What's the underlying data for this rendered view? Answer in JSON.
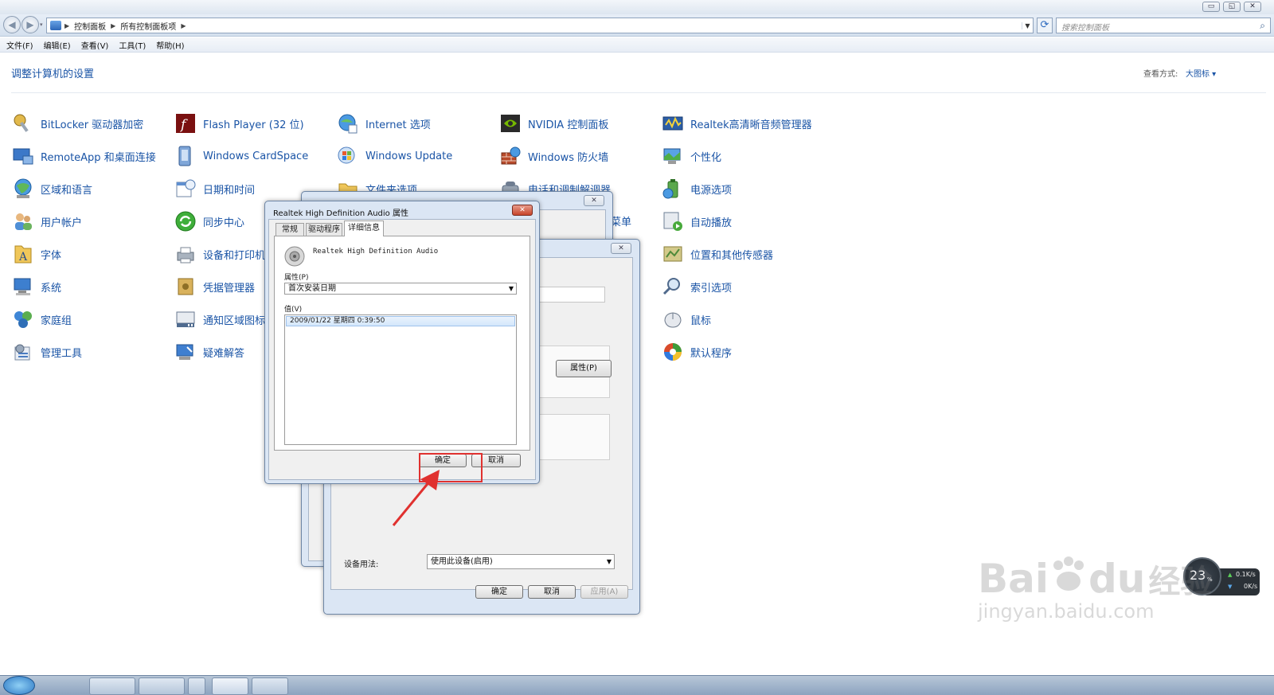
{
  "window": {
    "minimize": "▭",
    "restore": "◱",
    "close": "✕"
  },
  "address": {
    "crumbs": [
      "控制面板",
      "所有控制面板项"
    ],
    "search_placeholder": "搜索控制面板"
  },
  "menu": [
    "文件(F)",
    "编辑(E)",
    "查看(V)",
    "工具(T)",
    "帮助(H)"
  ],
  "header": {
    "title": "调整计算机的设置",
    "view_label": "查看方式:",
    "view_value": "大图标 ▾"
  },
  "columns": [
    [
      "BitLocker 驱动器加密",
      "RemoteApp 和桌面连接",
      "区域和语言",
      "用户帐户",
      "字体",
      "系统",
      "家庭组",
      "管理工具"
    ],
    [
      "Flash Player (32 位)",
      "Windows CardSpace",
      "日期和时间",
      "同步中心",
      "设备和打印机",
      "凭据管理器",
      "通知区域图标",
      "疑难解答"
    ],
    [
      "Internet 选项",
      "Windows Update"
    ],
    [
      "NVIDIA 控制面板",
      "Windows 防火墙"
    ],
    [
      "Realtek高清晰音频管理器",
      "个性化",
      "电源选项",
      "自动播放",
      "位置和其他传感器",
      "索引选项",
      "鼠标",
      "默认程序"
    ]
  ],
  "partial": {
    "col3_row3": "文件夹选项",
    "col4_row3": "电话和调制解调器",
    "col4_row4": "菜单"
  },
  "back_dialog": {
    "properties_button": "属性(P)",
    "usage_label": "设备用法:",
    "usage_value": "使用此设备(启用)",
    "ok": "确定",
    "cancel": "取消",
    "apply": "应用(A)"
  },
  "front_dialog": {
    "title": "Realtek High Definition Audio 属性",
    "tabs": [
      "常规",
      "驱动程序",
      "详细信息"
    ],
    "device_name": "Realtek High Definition Audio",
    "property_label": "属性(P)",
    "property_value": "首次安装日期",
    "value_label": "值(V)",
    "value_row": "2009/01/22 星期四 0:39:50",
    "ok": "确定",
    "cancel": "取消"
  },
  "meter": {
    "percent": "23",
    "unit": "%",
    "up": "0.1K/s",
    "down": "0K/s"
  },
  "watermark": {
    "brand": "Bai",
    "brand2": "du",
    "cn": "经验",
    "url": "jingyan.baidu.com"
  },
  "colors": {
    "link": "#1a54a6",
    "highlight": "#e0312f"
  }
}
